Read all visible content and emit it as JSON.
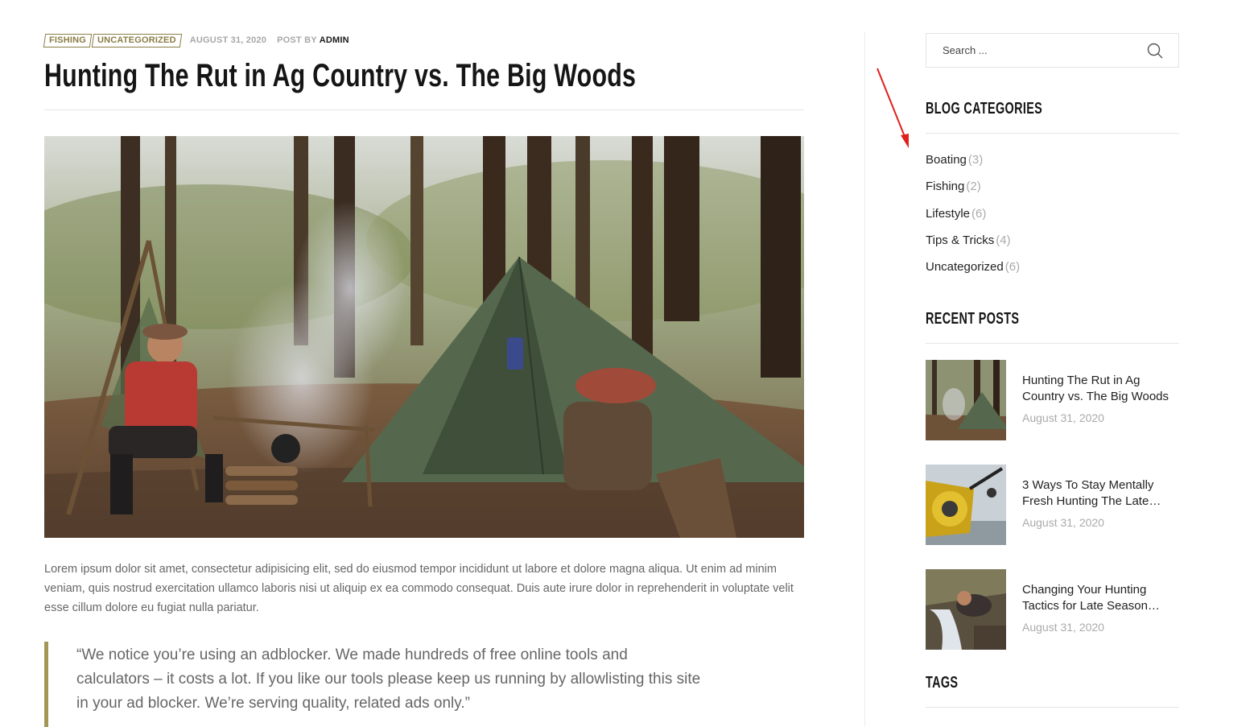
{
  "post": {
    "categories": [
      "FISHING",
      "UNCATEGORIZED"
    ],
    "date": "AUGUST 31, 2020",
    "by_label": "POST BY",
    "author": "ADMIN",
    "title": "Hunting The Rut in Ag Country vs. The Big Woods",
    "excerpt": "Lorem ipsum dolor sit amet, consectetur adipisicing elit, sed do eiusmod tempor incididunt ut labore et dolore magna aliqua. Ut enim ad minim veniam, quis nostrud exercitation ullamco laboris nisi ut aliquip ex ea commodo consequat. Duis aute irure dolor in reprehenderit in voluptate velit esse cillum dolore eu fugiat nulla pariatur.",
    "quote": "“We notice you’re using an adblocker. We made hundreds of free online tools and calculators – it costs a lot. If you like our tools please keep us running by allowlisting this site in your ad blocker. We’re serving quality, related ads only.”"
  },
  "sidebar": {
    "search": {
      "placeholder": "Search ...",
      "icon": "search-icon"
    },
    "categories_title": "BLOG CATEGORIES",
    "categories": [
      {
        "name": "Boating",
        "count": "(3)"
      },
      {
        "name": "Fishing",
        "count": "(2)"
      },
      {
        "name": "Lifestyle",
        "count": "(6)"
      },
      {
        "name": "Tips & Tricks",
        "count": "(4)"
      },
      {
        "name": "Uncategorized",
        "count": "(6)"
      }
    ],
    "recent_title": "RECENT POSTS",
    "recent_posts": [
      {
        "title": "Hunting The Rut in Ag Country vs. The Big Woods",
        "date": "August 31, 2020"
      },
      {
        "title": "3 Ways To Stay Mentally Fresh Hunting The Late…",
        "date": "August 31, 2020"
      },
      {
        "title": "Changing Your Hunting Tactics for Late Season…",
        "date": "August 31, 2020"
      }
    ],
    "tags_title": "TAGS"
  },
  "colors": {
    "accent": "#8a7d45",
    "quote_bar": "#a39758",
    "annotation_arrow": "#e0201b"
  }
}
